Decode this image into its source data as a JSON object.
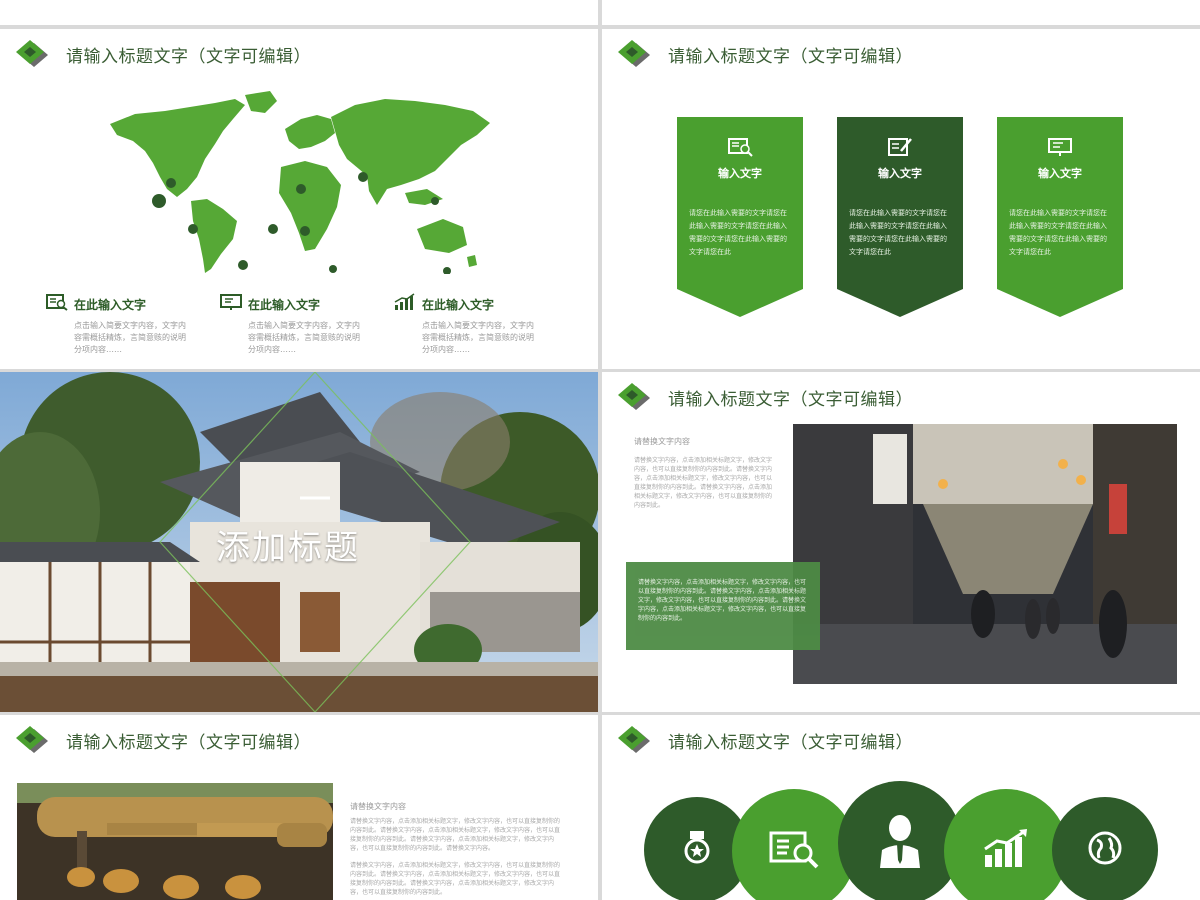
{
  "colors": {
    "accent_green": "#4a9f2f",
    "light_green": "#56a836",
    "dark_green": "#2e5b2a",
    "title_text": "#3a5d34"
  },
  "header_title": "请输入标题文字（文字可编辑）",
  "slide1": {
    "features": [
      {
        "icon": "book-search-icon",
        "title": "在此输入文字",
        "desc": "点击输入简要文字内容，文字内容需概括精炼，言简意赅的说明分项内容……"
      },
      {
        "icon": "presentation-board-icon",
        "title": "在此输入文字",
        "desc": "点击输入简要文字内容，文字内容需概括精炼，言简意赅的说明分项内容……"
      },
      {
        "icon": "bar-chart-icon",
        "title": "在此输入文字",
        "desc": "点击输入简要文字内容，文字内容需概括精炼，言简意赅的说明分项内容……"
      }
    ]
  },
  "slide2": {
    "cards": [
      {
        "icon": "book-search-icon",
        "title": "输入文字",
        "desc": "请您在此输入需要的文字请您在此输入需要的文字请您在此输入需要的文字请您在此输入需要的文字请您在此",
        "color": "#4a9f2f"
      },
      {
        "icon": "document-edit-icon",
        "title": "输入文字",
        "desc": "请您在此输入需要的文字请您在此输入需要的文字请您在此输入需要的文字请您在此输入需要的文字请您在此",
        "color": "#2e5b2a"
      },
      {
        "icon": "presentation-board-icon",
        "title": "输入文字",
        "desc": "请您在此输入需要的文字请您在此输入需要的文字请您在此输入需要的文字请您在此输入需要的文字请您在此",
        "color": "#4a9f2f"
      }
    ]
  },
  "slide3": {
    "title": "添加标题"
  },
  "slide4": {
    "subtitle": "请替换文字内容",
    "body": "请替换文字内容，点击添加相关标题文字，修改文字内容，也可以直接复制你的内容到此。请替换文字内容，点击添加相关标题文字，修改文字内容，也可以直接复制你的内容到此。请替换文字内容，点击添加相关标题文字，修改文字内容，也可以直接复制你的内容到此。",
    "box_text": "请替换文字内容，点击添加相关标题文字，修改文字内容，也可以直接复制你的内容到此。请替换文字内容，点击添加相关标题文字，修改文字内容，也可以直接复制你的内容到此。请替换文字内容，点击添加相关标题文字，修改文字内容，也可以直接复制你的内容到此。"
  },
  "slide5": {
    "subtitle": "请替换文字内容",
    "body1": "请替换文字内容，点击添加相关标题文字，修改文字内容，也可以直接复制你的内容到此。请替换文字内容，点击添加相关标题文字，修改文字内容，也可以直接复制你的内容到此。请替换文字内容，点击添加相关标题文字，修改文字内容，也可以直接复制你的内容到此。请替换文字内容。",
    "body2": "请替换文字内容，点击添加相关标题文字，修改文字内容，也可以直接复制你的内容到此。请替换文字内容，点击添加相关标题文字，修改文字内容，也可以直接复制你的内容到此。请替换文字内容，点击添加相关标题文字，修改文字内容，也可以直接复制你的内容到此。"
  },
  "slide6": {
    "circles": [
      {
        "icon": "medal-icon",
        "color": "#2e5b2a"
      },
      {
        "icon": "book-search-icon",
        "color": "#4a9f2f"
      },
      {
        "icon": "businessman-icon",
        "color": "#2e5b2a"
      },
      {
        "icon": "bar-chart-icon",
        "color": "#4a9f2f"
      },
      {
        "icon": "globe-icon",
        "color": "#2e5b2a"
      }
    ]
  }
}
